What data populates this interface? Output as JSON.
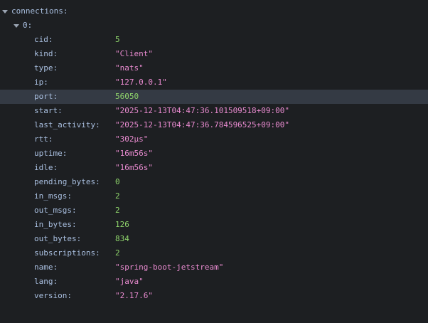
{
  "root": {
    "key": "connections:",
    "items": [
      {
        "index_label": "0:",
        "fields": [
          {
            "key": "cid:",
            "value": "5",
            "kind": "num"
          },
          {
            "key": "kind:",
            "value": "\"Client\"",
            "kind": "str"
          },
          {
            "key": "type:",
            "value": "\"nats\"",
            "kind": "str"
          },
          {
            "key": "ip:",
            "value": "\"127.0.0.1\"",
            "kind": "str"
          },
          {
            "key": "port:",
            "value": "56050",
            "kind": "num"
          },
          {
            "key": "start:",
            "value": "\"2025-12-13T04:47:36.101509518+09:00\"",
            "kind": "str"
          },
          {
            "key": "last_activity:",
            "value": "\"2025-12-13T04:47:36.784596525+09:00\"",
            "kind": "str"
          },
          {
            "key": "rtt:",
            "value": "\"302µs\"",
            "kind": "str"
          },
          {
            "key": "uptime:",
            "value": "\"16m56s\"",
            "kind": "str"
          },
          {
            "key": "idle:",
            "value": "\"16m56s\"",
            "kind": "str"
          },
          {
            "key": "pending_bytes:",
            "value": "0",
            "kind": "num"
          },
          {
            "key": "in_msgs:",
            "value": "2",
            "kind": "num"
          },
          {
            "key": "out_msgs:",
            "value": "2",
            "kind": "num"
          },
          {
            "key": "in_bytes:",
            "value": "126",
            "kind": "num"
          },
          {
            "key": "out_bytes:",
            "value": "834",
            "kind": "num"
          },
          {
            "key": "subscriptions:",
            "value": "2",
            "kind": "num"
          },
          {
            "key": "name:",
            "value": "\"spring-boot-jetstream\"",
            "kind": "str"
          },
          {
            "key": "lang:",
            "value": "\"java\"",
            "kind": "str"
          },
          {
            "key": "version:",
            "value": "\"2.17.6\"",
            "kind": "str"
          }
        ]
      }
    ]
  },
  "highlighted_field": "port:",
  "colors": {
    "background": "#1d1f22",
    "key": "#a9bfe0",
    "number": "#8ed36b",
    "string": "#e98bd0",
    "highlight": "#343a44"
  },
  "icons": {
    "expand_toggle": "triangle-down-icon"
  }
}
